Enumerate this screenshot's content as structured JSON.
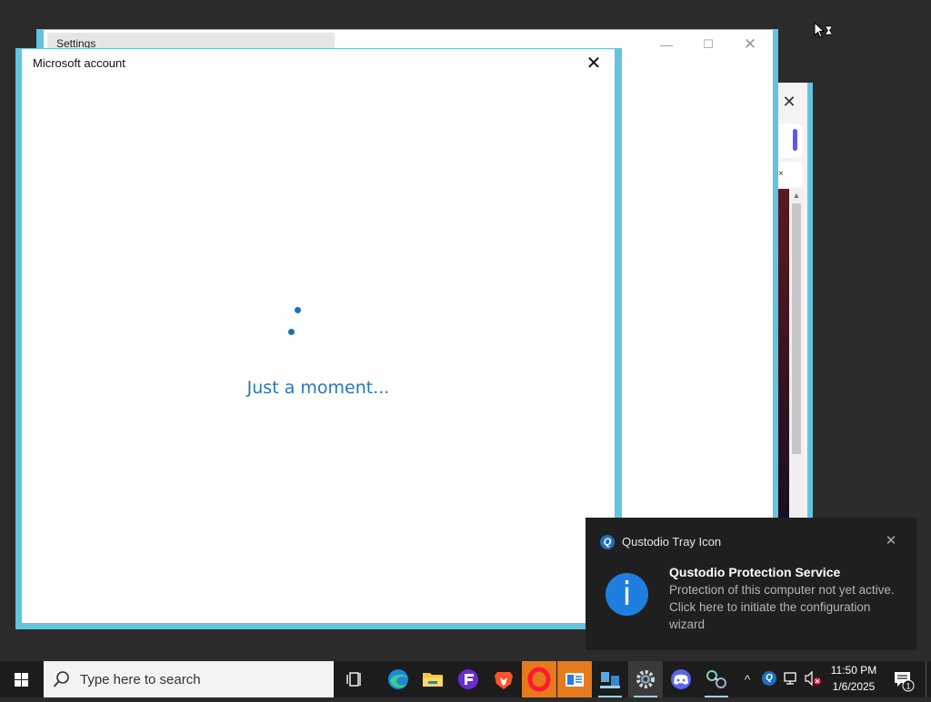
{
  "settings_window": {
    "title": "Settings",
    "controls": {
      "minimize": "—",
      "maximize": "☐",
      "close": "✕"
    }
  },
  "background_window": {
    "close": "✕",
    "tab_close": "×",
    "scroll_up": "▲"
  },
  "dialog": {
    "title": "Microsoft account",
    "close": "✕",
    "loading_text": "Just a moment..."
  },
  "notification": {
    "app_name": "Qustodio Tray Icon",
    "app_icon_glyph": "Q",
    "close": "✕",
    "info_glyph": "i",
    "title": "Qustodio Protection Service",
    "body": "Protection of this computer not yet active. Click here to initiate the configuration wizard"
  },
  "taskbar": {
    "search_placeholder": "Type here to search",
    "apps": [
      {
        "name": "task-view",
        "icon": "task-view-icon"
      },
      {
        "name": "edge",
        "icon": "edge-icon"
      },
      {
        "name": "file-explorer",
        "icon": "folder-icon"
      },
      {
        "name": "app-e",
        "icon": "e-app-icon"
      },
      {
        "name": "brave",
        "icon": "brave-icon"
      },
      {
        "name": "opera",
        "icon": "opera-icon"
      },
      {
        "name": "reader",
        "icon": "reader-icon"
      },
      {
        "name": "network-app",
        "icon": "network-icon"
      },
      {
        "name": "settings",
        "icon": "gear-icon"
      },
      {
        "name": "discord",
        "icon": "discord-icon"
      },
      {
        "name": "connections",
        "icon": "connection-icon"
      }
    ],
    "tray": {
      "chevron": "^",
      "qustodio_glyph": "Q",
      "time": "11:50 PM",
      "date": "1/6/2025",
      "notification_count": "1"
    }
  },
  "colors": {
    "window_border": "#64c3e0",
    "accent_blue": "#1f6fbf",
    "loading_text": "#2a76b5",
    "taskbar": "#1c1c1c"
  }
}
